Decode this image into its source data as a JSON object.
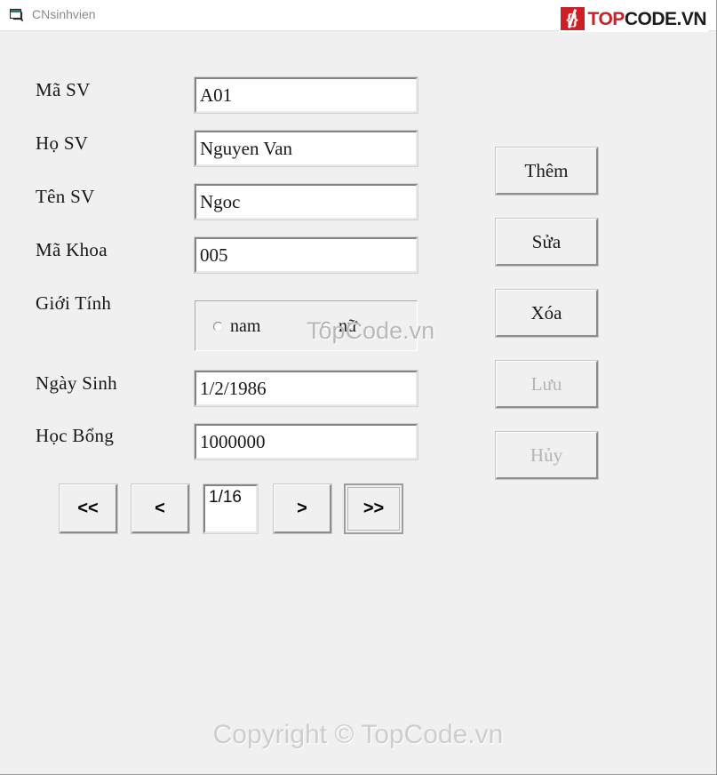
{
  "window": {
    "title": "CNsinhvien",
    "icon": "form-window-icon",
    "controls": {
      "minimize": "–",
      "maximize": "☐",
      "close": "✕"
    }
  },
  "brand": {
    "logo_mark_left": "{",
    "logo_mark_right": "}",
    "word_accent": "TOP",
    "word_rest": "CODE.VN",
    "accent_color": "#cc2026",
    "dark_color": "#1c1c1c"
  },
  "form": {
    "fields": [
      {
        "label": "Mã SV",
        "value": "A01"
      },
      {
        "label": "Họ SV",
        "value": "Nguyen Van"
      },
      {
        "label": "Tên SV",
        "value": "Ngoc"
      },
      {
        "label": "Mã Khoa",
        "value": "005"
      },
      {
        "label": "Giới Tính",
        "value": ""
      },
      {
        "label": "Ngày Sinh",
        "value": "1/2/1986"
      },
      {
        "label": "Học Bổng",
        "value": "1000000"
      }
    ],
    "gender": {
      "options": [
        {
          "label": "nam",
          "checked": false
        },
        {
          "label": "nữ",
          "checked": false
        }
      ]
    }
  },
  "actions": [
    {
      "label": "Thêm",
      "enabled": true
    },
    {
      "label": "Sửa",
      "enabled": true
    },
    {
      "label": "Xóa",
      "enabled": true
    },
    {
      "label": "Lưu",
      "enabled": false
    },
    {
      "label": "Hủy",
      "enabled": false
    }
  ],
  "navigation": {
    "first": "<<",
    "previous": "<",
    "position": "1/16",
    "next": ">",
    "last": ">>"
  },
  "watermarks": {
    "center": "TopCode.vn",
    "footer": "Copyright © TopCode.vn"
  }
}
